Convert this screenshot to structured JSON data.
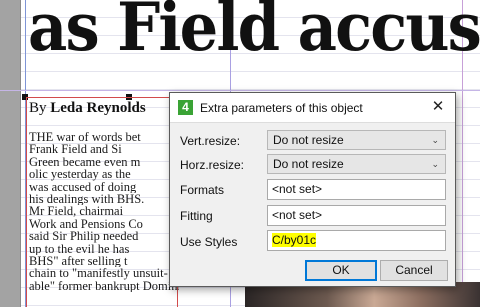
{
  "document": {
    "headline": "as Field accus",
    "byline_prefix": "By",
    "byline_author": "Leda Reynolds",
    "article_lines": [
      "THE war of words bet",
      "Frank Field and Si",
      "Green became even m",
      "olic yesterday as the",
      "was accused of doing",
      "his dealings with BHS.",
      "   Mr Field, chairmai",
      "Work and Pensions Co",
      "said Sir Philip needed",
      "up to the evil he has",
      "BHS\" after selling t",
      "chain to \"manifestly unsuit-",
      "able\" former bankrupt Dominic"
    ]
  },
  "dialog": {
    "icon_text": "4",
    "title": "Extra parameters of this object",
    "close_glyph": "✕",
    "vert_resize_label": "Vert.resize:",
    "vert_resize_value": "Do not resize",
    "horz_resize_label": "Horz.resize:",
    "horz_resize_value": "Do not resize",
    "formats_label": "Formats",
    "formats_value": "<not set>",
    "fitting_label": "Fitting",
    "fitting_value": "<not set>",
    "use_styles_label": "Use Styles",
    "use_styles_value": "C/by01c",
    "ok_label": "OK",
    "cancel_label": "Cancel",
    "dropdown_arrow": "⌄"
  },
  "colors": {
    "accent": "#0078d7",
    "app_icon": "#3aa335",
    "highlight": "#ffff00",
    "frame_red": "#d24b4b"
  }
}
